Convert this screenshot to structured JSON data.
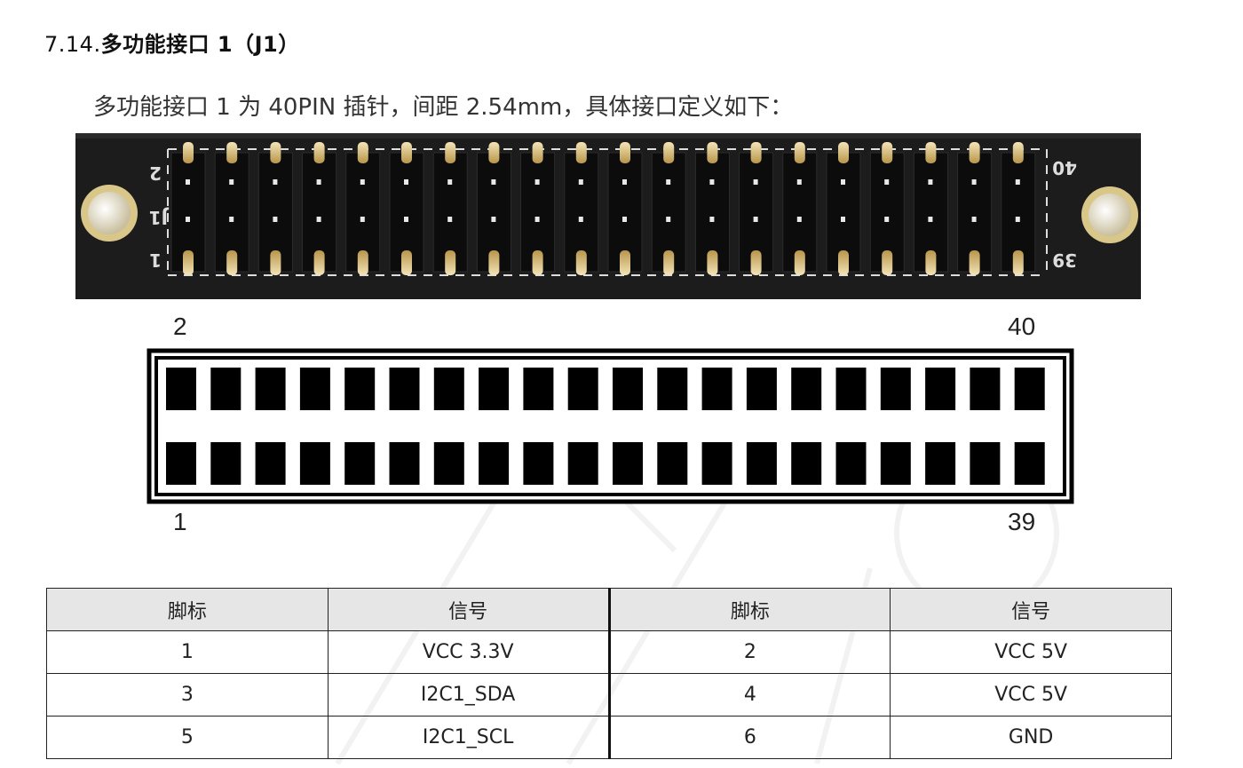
{
  "section": {
    "number": "7.14.",
    "title": "多功能接口 1（J1）"
  },
  "intro": "多功能接口 1 为 40PIN 插针，间距 2.54mm，具体接口定义如下：",
  "photo": {
    "silkscreen_left_top": "2",
    "silkscreen_left_mid": "J1",
    "silkscreen_left_bottom": "1",
    "silkscreen_right_top": "40",
    "silkscreen_right_bottom": "39"
  },
  "diagram": {
    "top_left_label": "2",
    "top_right_label": "40",
    "bottom_left_label": "1",
    "bottom_right_label": "39",
    "pins_per_row": 20
  },
  "table": {
    "headers": [
      "脚标",
      "信号",
      "脚标",
      "信号"
    ],
    "rows": [
      [
        "1",
        "VCC 3.3V",
        "2",
        "VCC 5V"
      ],
      [
        "3",
        "I2C1_SDA",
        "4",
        "VCC 5V"
      ],
      [
        "5",
        "I2C1_SCL",
        "6",
        "GND"
      ]
    ]
  }
}
